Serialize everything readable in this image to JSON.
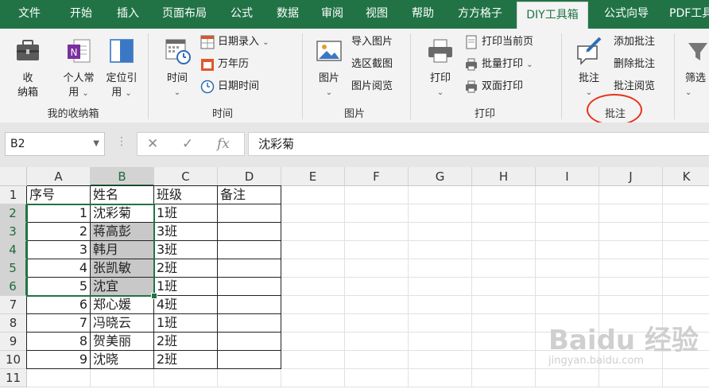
{
  "tabs": [
    {
      "label": "文件"
    },
    {
      "label": "开始"
    },
    {
      "label": "插入"
    },
    {
      "label": "页面布局"
    },
    {
      "label": "公式"
    },
    {
      "label": "数据"
    },
    {
      "label": "审阅"
    },
    {
      "label": "视图"
    },
    {
      "label": "帮助"
    },
    {
      "label": "方方格子"
    },
    {
      "label": "DIY工具箱",
      "active": true
    },
    {
      "label": "公式向导"
    },
    {
      "label": "PDF工具"
    }
  ],
  "ribbon": {
    "groups": {
      "storage": "我的收纳箱",
      "time": "时间",
      "image": "图片",
      "print": "打印",
      "comment": "批注"
    },
    "storage_btn": {
      "line1": "收",
      "line2": "纳箱"
    },
    "personal_btn": {
      "line1": "个人常",
      "line2": "用"
    },
    "locate_btn": {
      "line1": "定位引",
      "line2": "用"
    },
    "time_btn": "时间",
    "date_entry": "日期录入",
    "calendar": "万年历",
    "datetime": "日期时间",
    "image_btn": "图片",
    "import_image": "导入图片",
    "region_capture": "选区截图",
    "image_view": "图片阅览",
    "print_btn": "打印",
    "print_current": "打印当前页",
    "batch_print": "批量打印",
    "duplex_print": "双面打印",
    "comment_btn": "批注",
    "add_comment": "添加批注",
    "delete_comment": "删除批注",
    "view_comment": "批注阅览",
    "filter_btn": "筛选"
  },
  "formula_bar": {
    "name_box": "B2",
    "fx": "fx",
    "value": "沈彩菊"
  },
  "columns": [
    "A",
    "B",
    "C",
    "D",
    "E",
    "F",
    "G",
    "H",
    "I",
    "J",
    "K"
  ],
  "rows": [
    "1",
    "2",
    "3",
    "4",
    "5",
    "6",
    "7",
    "8",
    "9",
    "10",
    "11"
  ],
  "table": {
    "header": [
      "序号",
      "姓名",
      "班级",
      "备注"
    ],
    "data": [
      [
        "1",
        "沈彩菊",
        "1班",
        ""
      ],
      [
        "2",
        "蒋高彭",
        "3班",
        ""
      ],
      [
        "3",
        "韩月",
        "3班",
        ""
      ],
      [
        "4",
        "张凯敏",
        "2班",
        ""
      ],
      [
        "5",
        "沈宜",
        "1班",
        ""
      ],
      [
        "6",
        "郑心媛",
        "4班",
        ""
      ],
      [
        "7",
        "冯晓云",
        "1班",
        ""
      ],
      [
        "8",
        "贺美丽",
        "2班",
        ""
      ],
      [
        "9",
        "沈晓",
        "2班",
        ""
      ]
    ]
  },
  "watermark": {
    "main": "Baidu 经验",
    "sub": "jingyan.baidu.com"
  }
}
